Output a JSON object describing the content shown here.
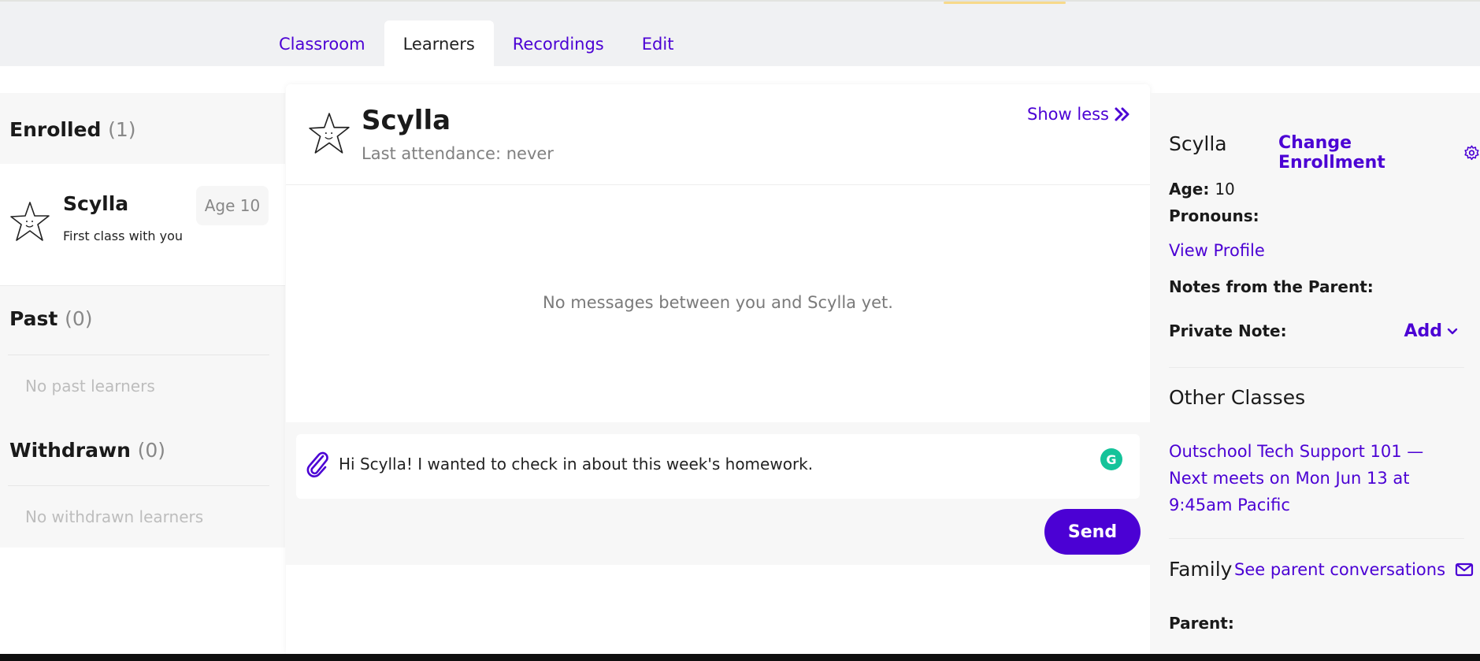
{
  "tabs": [
    {
      "label": "Classroom",
      "active": false
    },
    {
      "label": "Learners",
      "active": true
    },
    {
      "label": "Recordings",
      "active": false
    },
    {
      "label": "Edit",
      "active": false
    }
  ],
  "sidebar": {
    "enrolled": {
      "label": "Enrolled",
      "count": "(1)"
    },
    "learner": {
      "name": "Scylla",
      "subtitle": "First class with you",
      "age_badge": "Age 10",
      "avatar_icon": "star-face-icon"
    },
    "past": {
      "label": "Past",
      "count": "(0)",
      "empty_text": "No past learners"
    },
    "withdrawn": {
      "label": "Withdrawn",
      "count": "(0)",
      "empty_text": "No withdrawn learners"
    }
  },
  "conversation": {
    "name": "Scylla",
    "last_attendance": "Last attendance: never",
    "show_less_label": "Show less",
    "empty_text": "No messages between you and Scylla yet.",
    "message_value": "Hi Scylla! I wanted to check in about this week's homework.",
    "send_label": "Send",
    "grammarly_glyph": "G"
  },
  "details": {
    "name": "Scylla",
    "change_enrollment_label": "Change Enrollment",
    "age_label": "Age:",
    "age_value": "10",
    "pronouns_label": "Pronouns:",
    "view_profile_label": "View Profile",
    "parent_notes_label": "Notes from the Parent:",
    "private_note_label": "Private Note:",
    "add_label": "Add",
    "other_classes_heading": "Other Classes",
    "other_class_link": "Outschool Tech Support 101 — Next meets on Mon Jun 13 at 9:45am Pacific",
    "family_heading": "Family",
    "parent_conversations_label": "See parent conversations",
    "parent_label": "Parent:"
  },
  "colors": {
    "accent": "#4b01d4",
    "grammarly": "#15c39a",
    "panel_bg": "#f7f7f7",
    "header_bg": "#f0f1f3"
  }
}
